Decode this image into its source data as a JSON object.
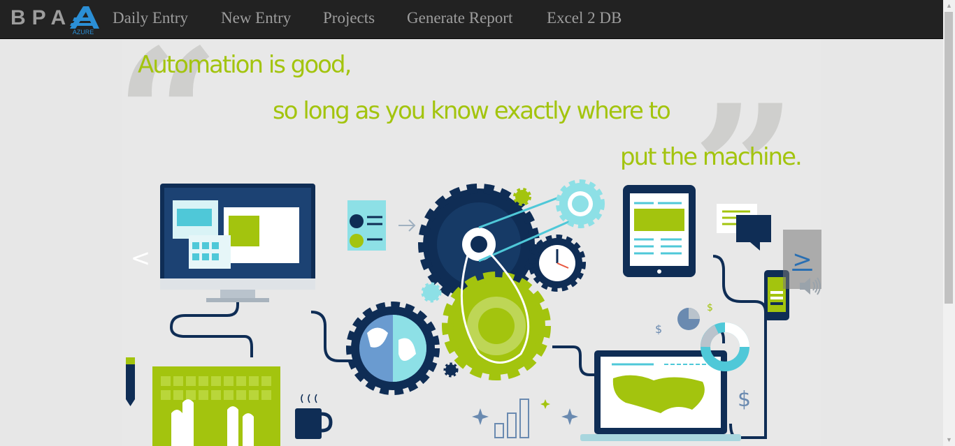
{
  "brand": {
    "text": "BPA",
    "logo_text": "AZURE",
    "logo_icon": "azure-logo-icon"
  },
  "nav": {
    "items": [
      {
        "label": "Daily Entry"
      },
      {
        "label": "New Entry"
      },
      {
        "label": "Projects"
      },
      {
        "label": "Generate Report"
      },
      {
        "label": "Excel 2 DB"
      }
    ]
  },
  "carousel": {
    "quote": {
      "line1": "Automation is good,",
      "line2": "so long as you know exactly where to",
      "line3": "put the machine."
    },
    "prev_label": "<",
    "next_label": ">",
    "speaker_icon": "speaker-icon",
    "illustration": "automation-gears-illustration"
  },
  "colors": {
    "navbar_bg": "#222222",
    "nav_text": "#9d9d9d",
    "quote_green": "#a3c40e",
    "navy": "#0f2d55",
    "teal": "#4fc8d8",
    "lime": "#a3c40e"
  }
}
